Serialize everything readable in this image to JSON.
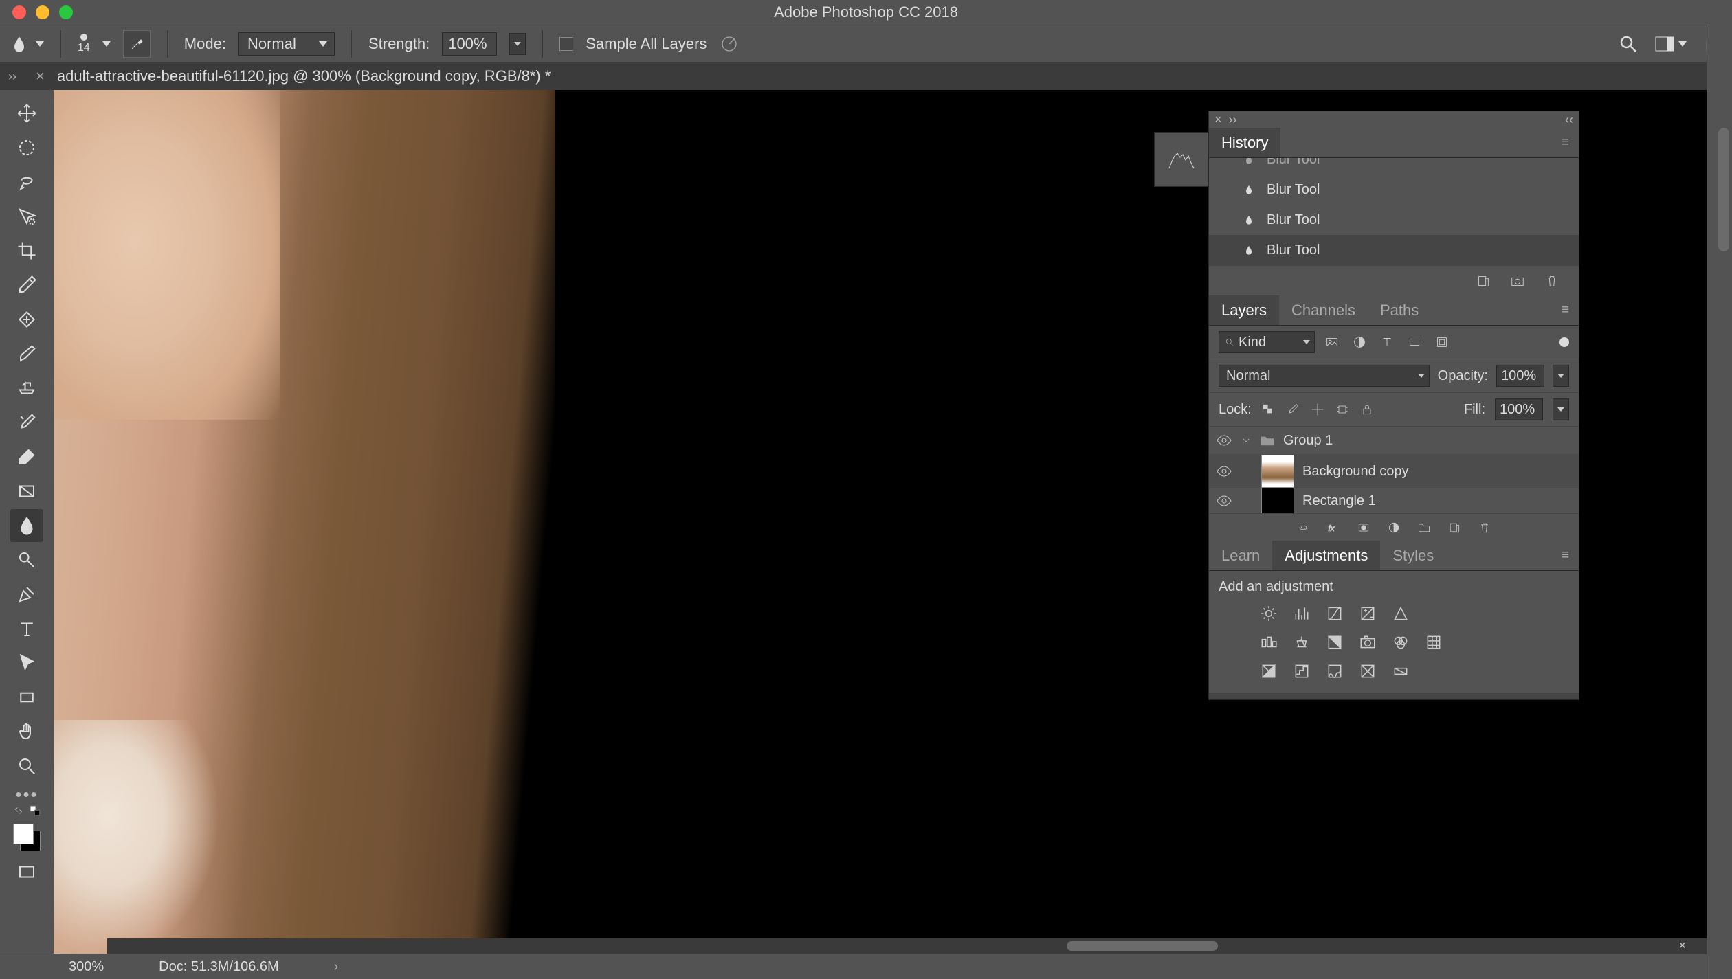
{
  "app": {
    "title": "Adobe Photoshop CC 2018"
  },
  "options": {
    "brush_size": "14",
    "mode_label": "Mode:",
    "mode_value": "Normal",
    "strength_label": "Strength:",
    "strength_value": "100%",
    "sample_all_label": "Sample All Layers"
  },
  "document": {
    "tab_title": "adult-attractive-beautiful-61120.jpg @ 300% (Background copy, RGB/8*) *"
  },
  "history": {
    "tab": "History",
    "items": [
      "Blur Tool",
      "Blur Tool",
      "Blur Tool",
      "Blur Tool"
    ]
  },
  "layers": {
    "tabs": {
      "layers": "Layers",
      "channels": "Channels",
      "paths": "Paths"
    },
    "filter_kind": "Kind",
    "blend_mode": "Normal",
    "opacity_label": "Opacity:",
    "opacity_value": "100%",
    "lock_label": "Lock:",
    "fill_label": "Fill:",
    "fill_value": "100%",
    "items": [
      {
        "name": "Group 1",
        "type": "group"
      },
      {
        "name": "Background copy",
        "type": "layer",
        "selected": true
      },
      {
        "name": "Rectangle 1",
        "type": "layer"
      }
    ]
  },
  "adjustments": {
    "tabs": {
      "learn": "Learn",
      "adjustments": "Adjustments",
      "styles": "Styles"
    },
    "add_label": "Add an adjustment"
  },
  "status": {
    "zoom": "300%",
    "doc_info": "Doc: 51.3M/106.6M"
  }
}
